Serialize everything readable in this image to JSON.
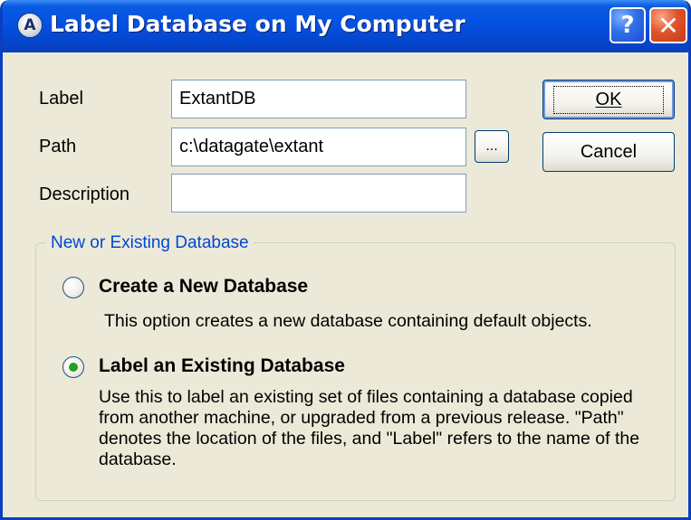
{
  "window": {
    "title": "Label Database on My Computer",
    "app_icon_glyph": "A",
    "help_glyph": "?",
    "close_glyph": "✕"
  },
  "form": {
    "label": {
      "caption": "Label",
      "value": "ExtantDB"
    },
    "path": {
      "caption": "Path",
      "value": "c:\\datagate\\extant"
    },
    "description": {
      "caption": "Description",
      "value": ""
    }
  },
  "buttons": {
    "ok": "OK",
    "cancel": "Cancel",
    "browse": "..."
  },
  "group": {
    "legend": "New or Existing Database",
    "options": [
      {
        "title": "Create a New Database",
        "description": "This option creates a new database containing default objects.",
        "checked": false
      },
      {
        "title": "Label an Existing Database",
        "description": "Use this to label an existing set of files containing a database copied from another machine, or upgraded from a previous release.  \"Path\" denotes the location of the files, and \"Label\" refers to the name of the database.",
        "checked": true
      }
    ]
  },
  "colors": {
    "titlebar": "#0553e3",
    "dialog_bg": "#ece9d8",
    "group_legend": "#0046d5",
    "radio_checked": "#21a121"
  }
}
